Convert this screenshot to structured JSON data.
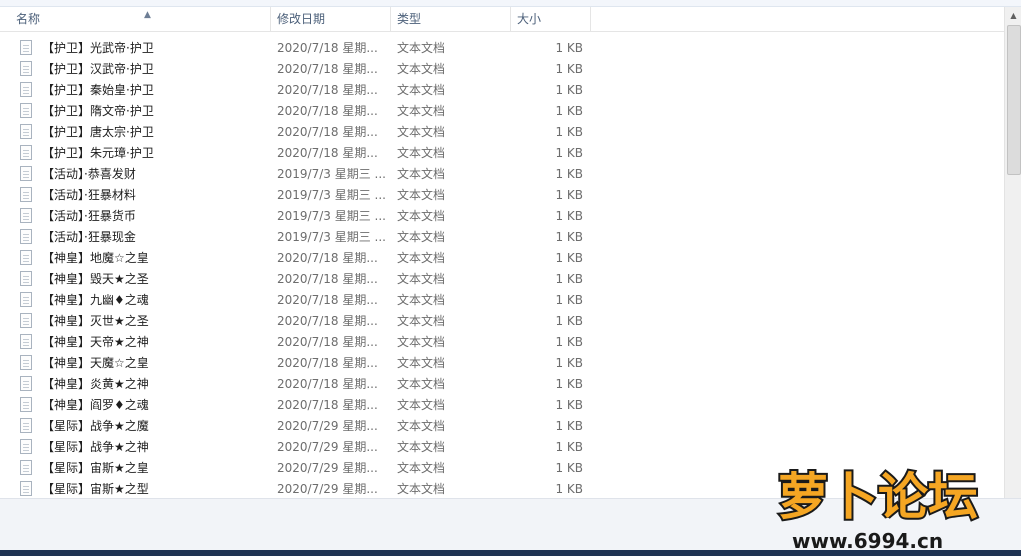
{
  "columns": {
    "name": "名称",
    "date": "修改日期",
    "type": "类型",
    "size": "大小"
  },
  "files": [
    {
      "name": "【护卫】光武帝·护卫",
      "date": "2020/7/18 星期...",
      "type": "文本文档",
      "size": "1 KB"
    },
    {
      "name": "【护卫】汉武帝·护卫",
      "date": "2020/7/18 星期...",
      "type": "文本文档",
      "size": "1 KB"
    },
    {
      "name": "【护卫】秦始皇·护卫",
      "date": "2020/7/18 星期...",
      "type": "文本文档",
      "size": "1 KB"
    },
    {
      "name": "【护卫】隋文帝·护卫",
      "date": "2020/7/18 星期...",
      "type": "文本文档",
      "size": "1 KB"
    },
    {
      "name": "【护卫】唐太宗·护卫",
      "date": "2020/7/18 星期...",
      "type": "文本文档",
      "size": "1 KB"
    },
    {
      "name": "【护卫】朱元璋·护卫",
      "date": "2020/7/18 星期...",
      "type": "文本文档",
      "size": "1 KB"
    },
    {
      "name": "【活动】·恭喜发财",
      "date": "2019/7/3 星期三 ...",
      "type": "文本文档",
      "size": "1 KB"
    },
    {
      "name": "【活动】·狂暴材料",
      "date": "2019/7/3 星期三 ...",
      "type": "文本文档",
      "size": "1 KB"
    },
    {
      "name": "【活动】·狂暴货币",
      "date": "2019/7/3 星期三 ...",
      "type": "文本文档",
      "size": "1 KB"
    },
    {
      "name": "【活动】·狂暴现金",
      "date": "2019/7/3 星期三 ...",
      "type": "文本文档",
      "size": "1 KB"
    },
    {
      "name": "【神皇】地魔☆之皇",
      "date": "2020/7/18 星期...",
      "type": "文本文档",
      "size": "1 KB"
    },
    {
      "name": "【神皇】毁天★之圣",
      "date": "2020/7/18 星期...",
      "type": "文本文档",
      "size": "1 KB"
    },
    {
      "name": "【神皇】九幽♦之魂",
      "date": "2020/7/18 星期...",
      "type": "文本文档",
      "size": "1 KB"
    },
    {
      "name": "【神皇】灭世★之圣",
      "date": "2020/7/18 星期...",
      "type": "文本文档",
      "size": "1 KB"
    },
    {
      "name": "【神皇】天帝★之神",
      "date": "2020/7/18 星期...",
      "type": "文本文档",
      "size": "1 KB"
    },
    {
      "name": "【神皇】天魔☆之皇",
      "date": "2020/7/18 星期...",
      "type": "文本文档",
      "size": "1 KB"
    },
    {
      "name": "【神皇】炎黄★之神",
      "date": "2020/7/18 星期...",
      "type": "文本文档",
      "size": "1 KB"
    },
    {
      "name": "【神皇】阎罗♦之魂",
      "date": "2020/7/18 星期...",
      "type": "文本文档",
      "size": "1 KB"
    },
    {
      "name": "【星际】战争★之魔",
      "date": "2020/7/29 星期...",
      "type": "文本文档",
      "size": "1 KB"
    },
    {
      "name": "【星际】战争★之神",
      "date": "2020/7/29 星期...",
      "type": "文本文档",
      "size": "1 KB"
    },
    {
      "name": "【星际】宙斯★之皇",
      "date": "2020/7/29 星期...",
      "type": "文本文档",
      "size": "1 KB"
    },
    {
      "name": "【星际】宙斯★之型",
      "date": "2020/7/29 星期...",
      "type": "文本文档",
      "size": "1 KB"
    }
  ],
  "watermark": {
    "title": "萝卜论坛",
    "url": "www.6994.cn"
  },
  "colors": {
    "header_text": "#4c607a",
    "row_text": "#1e1e1e",
    "meta_text": "#6d6d6d",
    "logo_fill": "#f5a623",
    "logo_outline": "#1a1a1a"
  },
  "icons": {
    "file": "text-file-icon",
    "sort": "sort-ascending-icon"
  }
}
